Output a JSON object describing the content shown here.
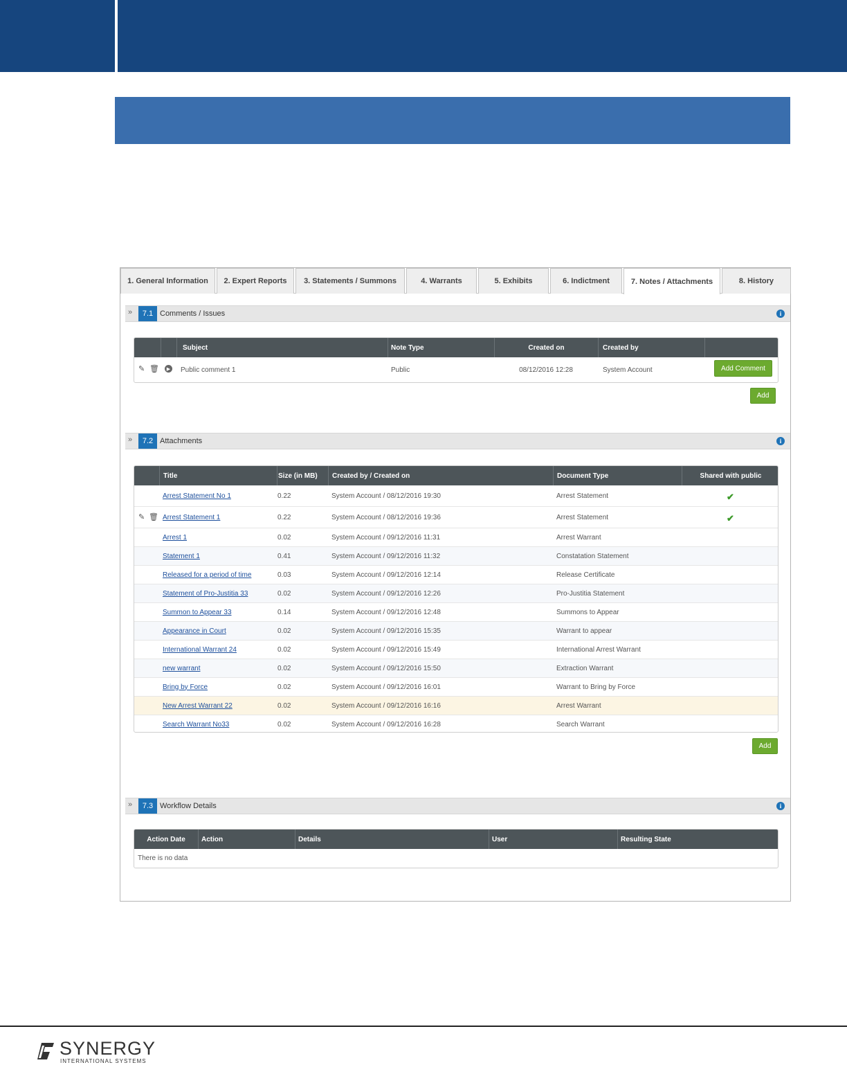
{
  "tabs": [
    {
      "label": "1. General Information"
    },
    {
      "label": "2. Expert Reports"
    },
    {
      "label": "3. Statements / Summons"
    },
    {
      "label": "4. Warrants"
    },
    {
      "label": "5. Exhibits"
    },
    {
      "label": "6. Indictment"
    },
    {
      "label": "7. Notes / Attachments"
    },
    {
      "label": "8. History"
    }
  ],
  "active_tab": "7. Notes / Attachments",
  "comments": {
    "number": "7.1",
    "title": "Comments / Issues",
    "headers": {
      "subject": "Subject",
      "note_type": "Note Type",
      "created_on": "Created on",
      "created_by": "Created by"
    },
    "rows": [
      {
        "subject": "Public comment 1",
        "note_type": "Public",
        "created_on": "08/12/2016 12:28",
        "created_by": "System Account",
        "action": "Add Comment"
      }
    ],
    "add_label": "Add"
  },
  "attachments": {
    "number": "7.2",
    "title": "Attachments",
    "headers": {
      "title": "Title",
      "size": "Size (in MB)",
      "created": "Created by / Created on",
      "doc_type": "Document Type",
      "shared": "Shared with public"
    },
    "rows": [
      {
        "title": "Arrest Statement No 1",
        "size": "0.22",
        "created": "System Account / 08/12/2016 19:30",
        "doc_type": "Arrest Statement",
        "shared": true
      },
      {
        "title": "Arrest Statement 1",
        "size": "0.22",
        "created": "System Account / 08/12/2016 19:36",
        "doc_type": "Arrest Statement",
        "shared": true
      },
      {
        "title": "Arrest 1",
        "size": "0.02",
        "created": "System Account / 09/12/2016 11:31",
        "doc_type": "Arrest Warrant",
        "shared": false
      },
      {
        "title": "Statement 1",
        "size": "0.41",
        "created": "System Account / 09/12/2016 11:32",
        "doc_type": "Constatation Statement",
        "shared": false
      },
      {
        "title": "Released for a period of time",
        "size": "0.03",
        "created": "System Account / 09/12/2016 12:14",
        "doc_type": "Release Certificate",
        "shared": false
      },
      {
        "title": "Statement of Pro-Justitia 33",
        "size": "0.02",
        "created": "System Account / 09/12/2016 12:26",
        "doc_type": "Pro-Justitia Statement",
        "shared": false
      },
      {
        "title": "Summon to Appear 33",
        "size": "0.14",
        "created": "System Account / 09/12/2016 12:48",
        "doc_type": "Summons to Appear",
        "shared": false
      },
      {
        "title": "Appearance in Court",
        "size": "0.02",
        "created": "System Account / 09/12/2016 15:35",
        "doc_type": "Warrant to appear",
        "shared": false
      },
      {
        "title": "International Warrant 24",
        "size": "0.02",
        "created": "System Account / 09/12/2016 15:49",
        "doc_type": "International Arrest Warrant",
        "shared": false
      },
      {
        "title": "new warrant",
        "size": "0.02",
        "created": "System Account / 09/12/2016 15:50",
        "doc_type": "Extraction Warrant",
        "shared": false
      },
      {
        "title": "Bring by Force",
        "size": "0.02",
        "created": "System Account / 09/12/2016 16:01",
        "doc_type": "Warrant to Bring by Force",
        "shared": false
      },
      {
        "title": "New Arrest Warrant 22",
        "size": "0.02",
        "created": "System Account / 09/12/2016 16:16",
        "doc_type": "Arrest Warrant",
        "shared": false
      },
      {
        "title": "Search Warrant No33",
        "size": "0.02",
        "created": "System Account / 09/12/2016 16:28",
        "doc_type": "Search Warrant",
        "shared": false
      }
    ],
    "add_label": "Add"
  },
  "workflow": {
    "number": "7.3",
    "title": "Workflow Details",
    "headers": {
      "action_date": "Action Date",
      "action": "Action",
      "details": "Details",
      "user": "User",
      "resulting_state": "Resulting State"
    },
    "empty_text": "There is no data"
  },
  "footer": {
    "logo_main": "SYNERGY",
    "logo_sub": "INTERNATIONAL SYSTEMS"
  },
  "colors": {
    "banner": "#16457e",
    "sub_banner": "#3a6ead",
    "accent_blue": "#1f73b7",
    "button_green": "#6caa2f",
    "table_header": "#4d5559"
  },
  "icons": {
    "collapse": "double-chevron-down-icon",
    "info": "info-icon",
    "edit": "pencil-icon",
    "delete": "trash-icon",
    "expand_row": "play-circle-icon",
    "shared": "check-icon"
  }
}
